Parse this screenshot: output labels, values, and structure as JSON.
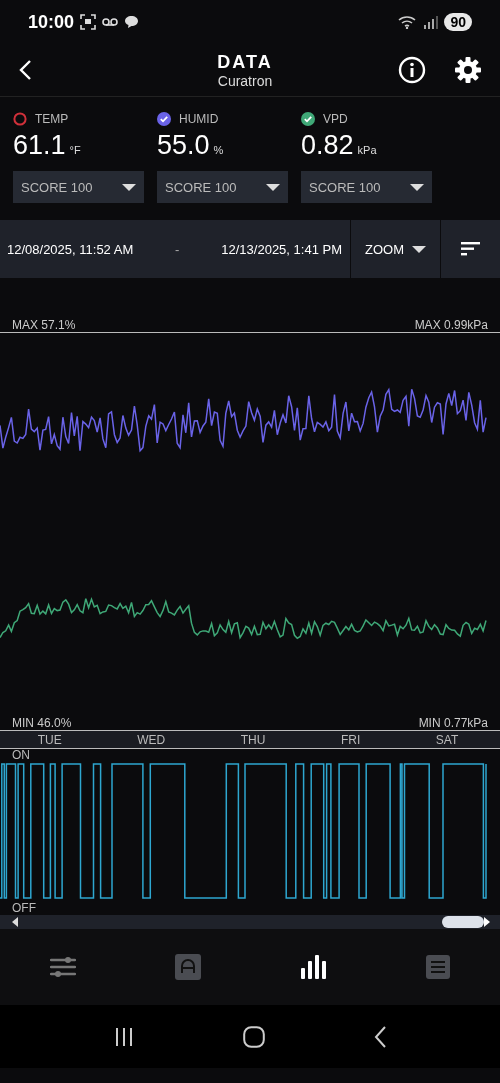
{
  "status_bar": {
    "time": "10:00",
    "battery": "90"
  },
  "header": {
    "title": "DATA",
    "subtitle": "Curatron"
  },
  "sensors": [
    {
      "label": "TEMP",
      "value": "61.1",
      "unit": "°F",
      "checked": false,
      "color": "#d0303a",
      "score": "SCORE 100"
    },
    {
      "label": "HUMID",
      "value": "55.0",
      "unit": "%",
      "checked": true,
      "color": "#6a63e8",
      "score": "SCORE 100"
    },
    {
      "label": "VPD",
      "value": "0.82",
      "unit": "kPa",
      "checked": true,
      "color": "#3fa877",
      "score": "SCORE 100"
    }
  ],
  "range": {
    "start": "12/08/2025, 11:52 AM",
    "separator": "-",
    "end": "12/13/2025, 1:41 PM",
    "zoom": "ZOOM"
  },
  "chart": {
    "max_left": "MAX 57.1%",
    "max_right": "MAX 0.99kPa",
    "min_left": "MIN 46.0%",
    "min_right": "MIN 0.77kPa"
  },
  "days": [
    "TUE",
    "WED",
    "THU",
    "FRI",
    "SAT"
  ],
  "switch_chart": {
    "on_label": "ON",
    "off_label": "OFF"
  },
  "nav": [
    {
      "kind": "sliders",
      "selected": false
    },
    {
      "kind": "auto",
      "selected": false
    },
    {
      "kind": "bars",
      "selected": true
    },
    {
      "kind": "list",
      "selected": false
    }
  ]
}
